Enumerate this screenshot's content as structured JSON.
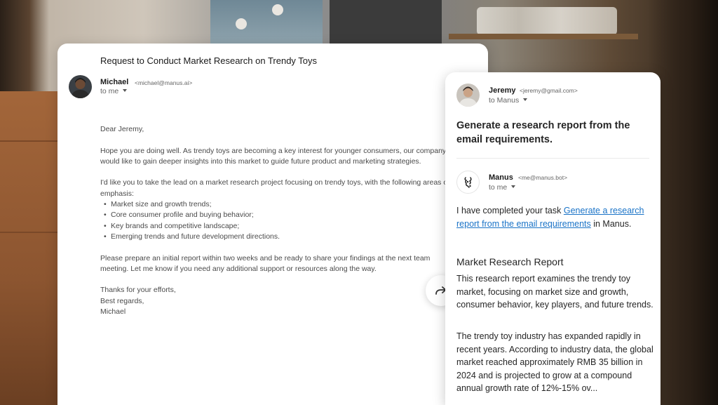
{
  "left_email": {
    "subject": "Request to Conduct Market Research on Trendy Toys",
    "sender_name": "Michael",
    "sender_email": "<michael@manus.ai>",
    "to": "to me",
    "greeting": "Dear Jeremy,",
    "paragraph_1": "Hope you are doing well. As trendy toys are becoming a key interest for younger consumers, our company would like to gain deeper insights into this market to guide future product and marketing strategies.",
    "paragraph_2": "I'd like you to take the lead on a market research project focusing on trendy toys, with the following areas of emphasis:",
    "bullets": [
      "Market size and growth trends;",
      "Core consumer profile and buying behavior;",
      "Key brands and competitive landscape;",
      "Emerging trends and future development directions."
    ],
    "paragraph_3": "Please prepare an initial report within two weeks and be ready to share your findings at the next team meeting. Let me know if you need any additional support or resources along the way.",
    "closing_1": "Thanks for your efforts,",
    "closing_2": "Best regards,",
    "signature": "Michael"
  },
  "right_panel": {
    "forward_sender_name": "Jeremy",
    "forward_sender_email": "<jeremy@gmail.com>",
    "forward_to": "to Manus",
    "prompt": "Generate a research report from the email requirements.",
    "reply_sender_name": "Manus",
    "reply_sender_email": "<me@manus.bot>",
    "reply_to": "to me",
    "reply_prefix": "I have completed your task ",
    "reply_link": "Generate a research report from the email requirements",
    "reply_suffix": " in Manus.",
    "report_title": "Market Research Report",
    "report_para_1": "This research report examines the trendy toy market, focusing on market size and growth, consumer behavior, key players, and future trends.",
    "report_para_2": "The trendy toy industry has expanded rapidly in recent years. According to industry data, the global market reached approximately RMB 35 billion in 2024 and is projected to grow at a compound annual growth rate of 12%-15% ov..."
  },
  "icons": {
    "forward": "forward-arrow-icon",
    "caret": "chevron-down-icon",
    "manus_logo": "manus-logo-icon"
  },
  "colors": {
    "link": "#1a73c7",
    "text_primary": "#262626",
    "text_secondary": "#666666"
  }
}
